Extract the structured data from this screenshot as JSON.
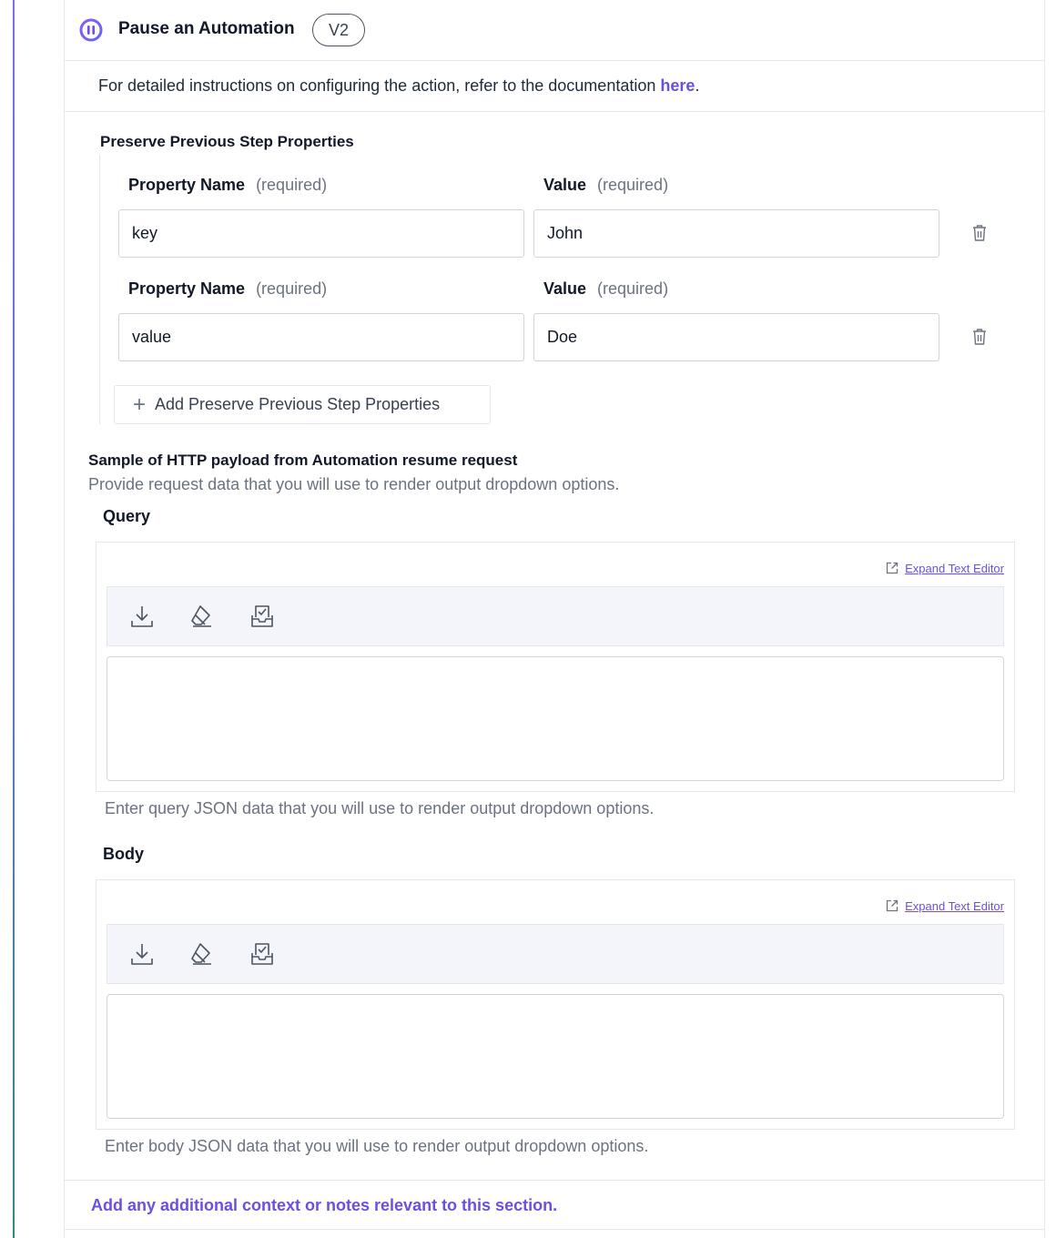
{
  "header": {
    "title": "Pause an Automation",
    "version": "V2",
    "icon": "pause-circle-icon"
  },
  "docs": {
    "text": "For detailed instructions on configuring the action, refer to the documentation ",
    "link_label": "here",
    "suffix": "."
  },
  "preserve": {
    "title": "Preserve Previous Step Properties",
    "rows": [
      {
        "name_label": "Property Name",
        "name_required": "(required)",
        "value_label": "Value",
        "value_required": "(required)",
        "name_value": "key",
        "value_value": "John"
      },
      {
        "name_label": "Property Name",
        "name_required": "(required)",
        "value_label": "Value",
        "value_required": "(required)",
        "name_value": "value",
        "value_value": "Doe"
      }
    ],
    "add_label": "Add Preserve Previous Step Properties"
  },
  "sample": {
    "title": "Sample of HTTP payload from Automation resume request",
    "description": "Provide request data that you will use to render output dropdown options."
  },
  "query": {
    "label": "Query",
    "expand_label": "Expand Text Editor",
    "hint": "Enter query JSON data that you will use to render output dropdown options.",
    "value": ""
  },
  "body": {
    "label": "Body",
    "expand_label": "Expand Text Editor",
    "hint": "Enter body JSON data that you will use to render output dropdown options.",
    "value": ""
  },
  "notes": {
    "label": "Add any additional context or notes relevant to this section."
  },
  "colors": {
    "accent": "#6d4fe0",
    "muted_text": "#6b7280",
    "border": "#e5e7eb",
    "toolbar_bg": "#f3f5fa"
  }
}
